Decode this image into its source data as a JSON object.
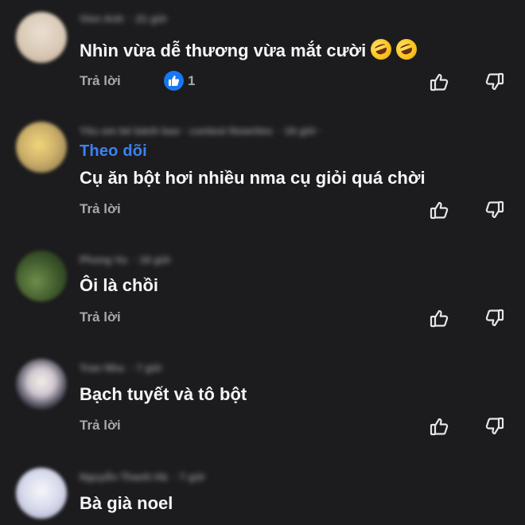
{
  "comments": [
    {
      "name": "Vien Anh",
      "time": "21 giờ",
      "text": "Nhìn vừa dễ thương vừa mắt cười",
      "emojis": [
        "rolling-on-floor-laughing-emoji",
        "rolling-on-floor-laughing-emoji"
      ],
      "reply_label": "Trả lời",
      "like_count": "1"
    },
    {
      "name": "Yêu em bé bánh bao · contest Nowrites",
      "time": "16 giờ",
      "follow_label": "Theo dõi",
      "text": "Cụ ăn bột hơi nhiều nma cụ giỏi quá chời",
      "reply_label": "Trả lời"
    },
    {
      "name": "Phong Vu",
      "time": "16 giờ",
      "text": "Ôi là chồi",
      "reply_label": "Trả lời"
    },
    {
      "name": "Tran Nhu",
      "time": "7 giờ",
      "text": "Bạch tuyết và tô bột",
      "reply_label": "Trả lời"
    },
    {
      "name": "Nguyễn Thanh Hà",
      "time": "7 giờ",
      "text": "Bà già noel"
    }
  ],
  "colors": {
    "background": "#1c1c1e",
    "accent": "#3b82f6",
    "like_badge": "#1877f2"
  }
}
